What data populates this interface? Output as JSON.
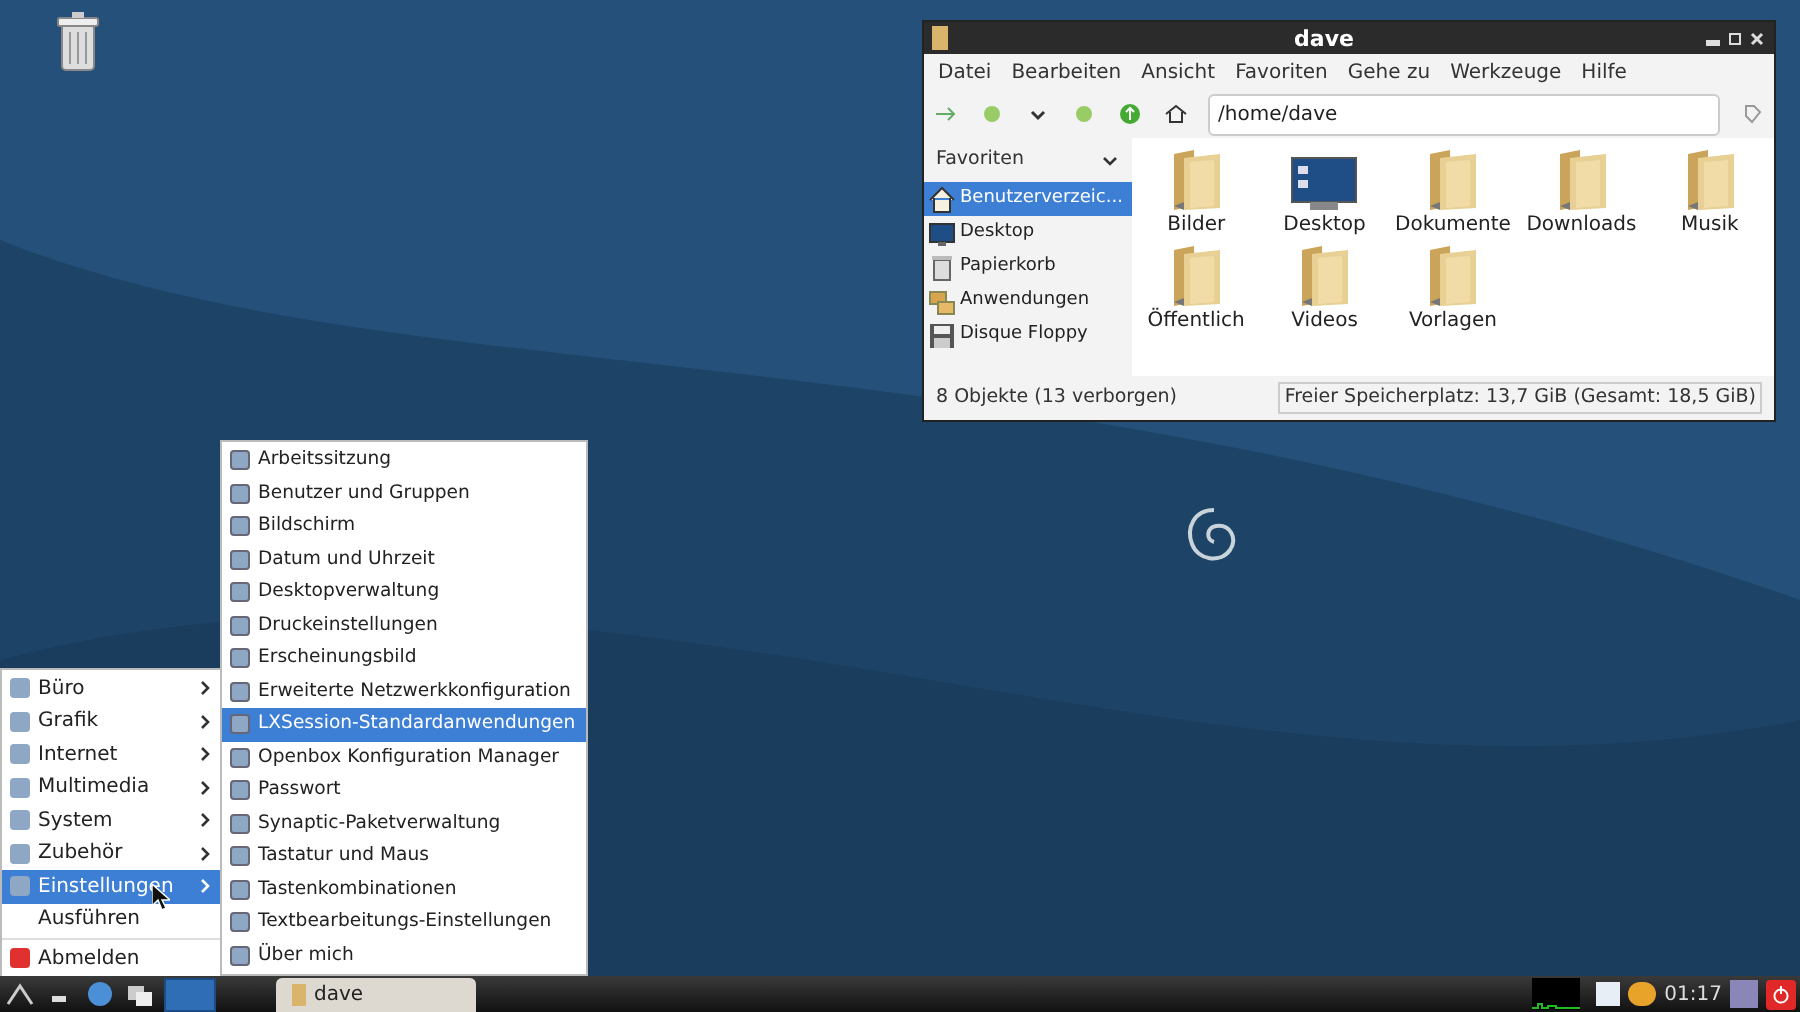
{
  "file_manager": {
    "title": "dave",
    "menu": [
      "Datei",
      "Bearbeiten",
      "Ansicht",
      "Favoriten",
      "Gehe zu",
      "Werkzeuge",
      "Hilfe"
    ],
    "path": "/home/dave",
    "sidebar": {
      "header": "Favoriten",
      "items": [
        {
          "label": "Benutzerverzeic...",
          "kind": "home",
          "selected": true
        },
        {
          "label": "Desktop",
          "kind": "desktop",
          "selected": false
        },
        {
          "label": "Papierkorb",
          "kind": "trash",
          "selected": false
        },
        {
          "label": "Anwendungen",
          "kind": "apps",
          "selected": false
        },
        {
          "label": "Disque Floppy",
          "kind": "floppy",
          "selected": false
        }
      ]
    },
    "files": [
      {
        "label": "Bilder",
        "kind": "folder"
      },
      {
        "label": "Desktop",
        "kind": "desktop"
      },
      {
        "label": "Dokumente",
        "kind": "folder"
      },
      {
        "label": "Downloads",
        "kind": "folder"
      },
      {
        "label": "Musik",
        "kind": "folder"
      },
      {
        "label": "Öffentlich",
        "kind": "folder"
      },
      {
        "label": "Videos",
        "kind": "folder"
      },
      {
        "label": "Vorlagen",
        "kind": "folder"
      }
    ],
    "status_left": "8 Objekte (13 verborgen)",
    "status_right": "Freier Speicherplatz: 13,7 GiB (Gesamt: 18,5 GiB)"
  },
  "start_menu": {
    "items": [
      {
        "label": "Büro",
        "submenu": true,
        "icon": true,
        "selected": false
      },
      {
        "label": "Grafik",
        "submenu": true,
        "icon": true,
        "selected": false
      },
      {
        "label": "Internet",
        "submenu": true,
        "icon": true,
        "selected": false
      },
      {
        "label": "Multimedia",
        "submenu": true,
        "icon": true,
        "selected": false
      },
      {
        "label": "System",
        "submenu": true,
        "icon": true,
        "selected": false
      },
      {
        "label": "Zubehör",
        "submenu": true,
        "icon": true,
        "selected": false
      },
      {
        "label": "Einstellungen",
        "submenu": true,
        "icon": true,
        "selected": true
      },
      {
        "label": "Ausführen",
        "submenu": false,
        "icon": false,
        "selected": false
      },
      {
        "label": "Abmelden",
        "submenu": false,
        "icon": true,
        "selected": false
      }
    ]
  },
  "settings_menu": {
    "items": [
      {
        "label": "Arbeitssitzung",
        "selected": false
      },
      {
        "label": "Benutzer und Gruppen",
        "selected": false
      },
      {
        "label": "Bildschirm",
        "selected": false
      },
      {
        "label": "Datum und Uhrzeit",
        "selected": false
      },
      {
        "label": "Desktopverwaltung",
        "selected": false
      },
      {
        "label": "Druckeinstellungen",
        "selected": false
      },
      {
        "label": "Erscheinungsbild",
        "selected": false
      },
      {
        "label": "Erweiterte Netzwerkkonfiguration",
        "selected": false
      },
      {
        "label": "LXSession-Standardanwendungen",
        "selected": true
      },
      {
        "label": "Openbox Konfiguration Manager",
        "selected": false
      },
      {
        "label": "Passwort",
        "selected": false
      },
      {
        "label": "Synaptic-Paketverwaltung",
        "selected": false
      },
      {
        "label": "Tastatur und Maus",
        "selected": false
      },
      {
        "label": "Tastenkombinationen",
        "selected": false
      },
      {
        "label": "Textbearbeitungs-Einstellungen",
        "selected": false
      },
      {
        "label": "Über mich",
        "selected": false
      }
    ]
  },
  "taskbar": {
    "task": "dave",
    "clock": "01:17"
  }
}
